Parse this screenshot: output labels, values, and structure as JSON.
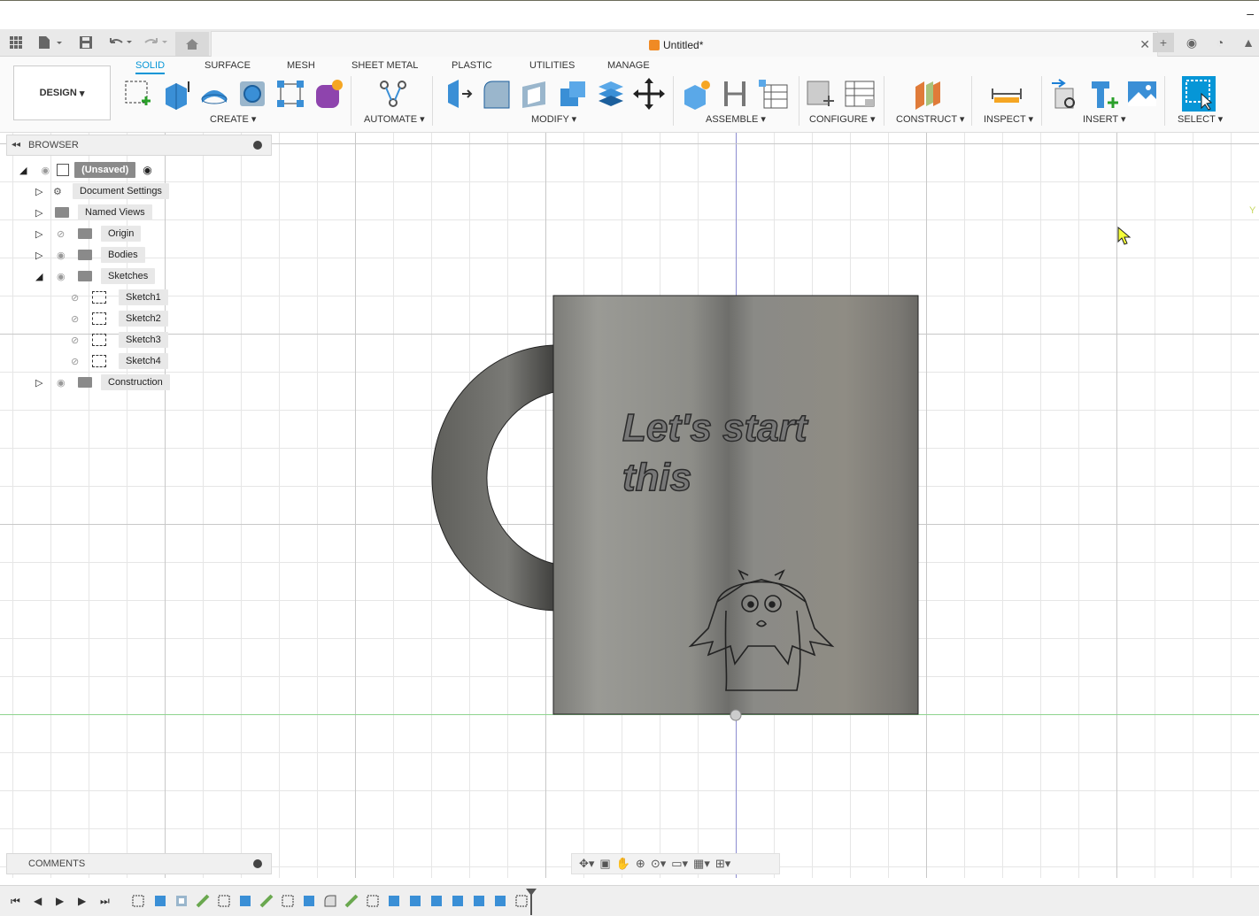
{
  "app": {
    "document_title": "Untitled*"
  },
  "ribbon": {
    "workspace": "DESIGN",
    "tabs": [
      "SOLID",
      "SURFACE",
      "MESH",
      "SHEET METAL",
      "PLASTIC",
      "UTILITIES",
      "MANAGE"
    ],
    "active_tab": "SOLID",
    "groups": [
      "CREATE",
      "AUTOMATE",
      "MODIFY",
      "ASSEMBLE",
      "CONFIGURE",
      "CONSTRUCT",
      "INSPECT",
      "INSERT",
      "SELECT"
    ]
  },
  "browser": {
    "title": "BROWSER",
    "root": "(Unsaved)",
    "items": [
      {
        "label": "Document Settings"
      },
      {
        "label": "Named Views"
      },
      {
        "label": "Origin"
      },
      {
        "label": "Bodies"
      },
      {
        "label": "Sketches"
      },
      {
        "label": "Sketch1"
      },
      {
        "label": "Sketch2"
      },
      {
        "label": "Sketch3"
      },
      {
        "label": "Sketch4"
      },
      {
        "label": "Construction"
      }
    ]
  },
  "comments": {
    "title": "COMMENTS"
  },
  "model": {
    "engraved_text_line1": "Let's start",
    "engraved_text_line2": "this"
  },
  "viewcube": {
    "axis_label": "Y"
  },
  "colors": {
    "accent": "#0696d7",
    "mug_body": "#8f8f8a",
    "grid": "#e6e6e6"
  }
}
